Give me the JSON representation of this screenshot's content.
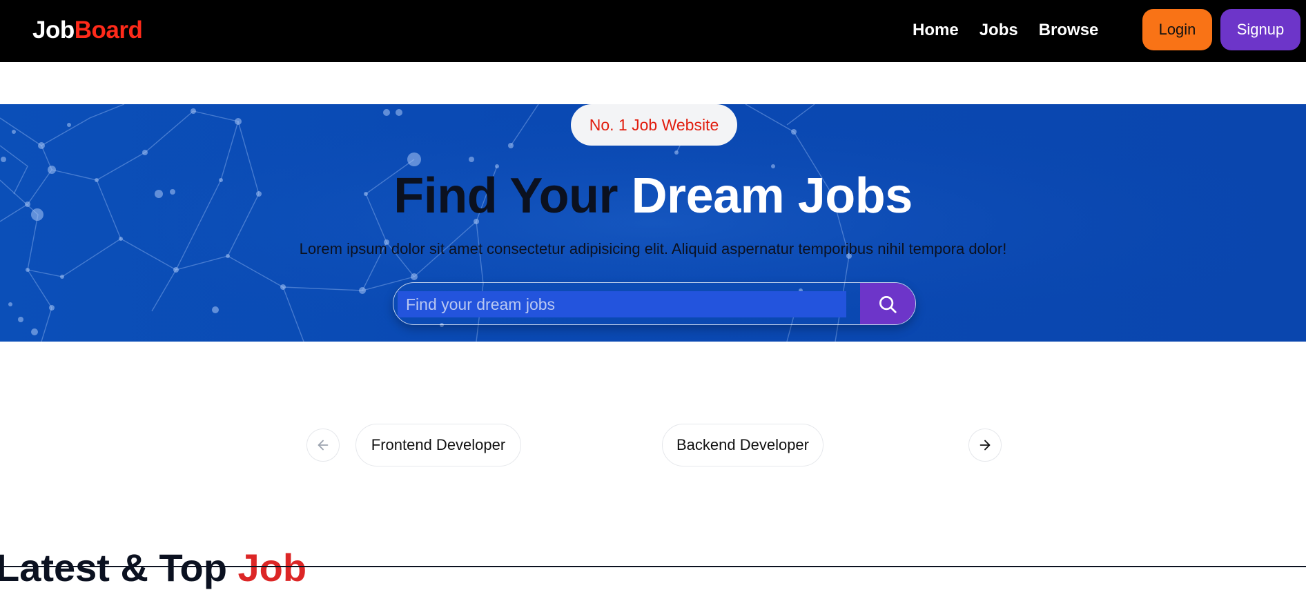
{
  "navbar": {
    "logo_part_a": "Job",
    "logo_part_b": "Board",
    "links": [
      {
        "label": "Home"
      },
      {
        "label": "Jobs"
      },
      {
        "label": "Browse"
      }
    ],
    "login_label": "Login",
    "signup_label": "Signup"
  },
  "hero": {
    "badge": "No. 1 Job Website",
    "title_part_a": "Find Your ",
    "title_part_b": "Dream Jobs",
    "subtitle": "Lorem ipsum dolor sit amet consectetur adipisicing elit. Aliquid aspernatur temporibus nihil tempora dolor!",
    "search": {
      "placeholder": "Find your dream jobs",
      "value": "",
      "button_icon": "search-icon"
    }
  },
  "carousel": {
    "prev_icon": "arrow-left-icon",
    "next_icon": "arrow-right-icon",
    "items": [
      {
        "label": "Frontend Developer"
      },
      {
        "label": "Backend Developer"
      }
    ]
  },
  "latest": {
    "title_part_a": "Latest & Top ",
    "title_part_b": "Job"
  },
  "colors": {
    "navbar_bg": "#000000",
    "logo_accent": "#ff2a1a",
    "login_bg": "#f97316",
    "signup_bg": "#6d35c9",
    "hero_bg": "#0a4ab4",
    "badge_text": "#e11d0e",
    "search_button_bg": "#6d35c9",
    "heading_accent": "#dc2626"
  }
}
